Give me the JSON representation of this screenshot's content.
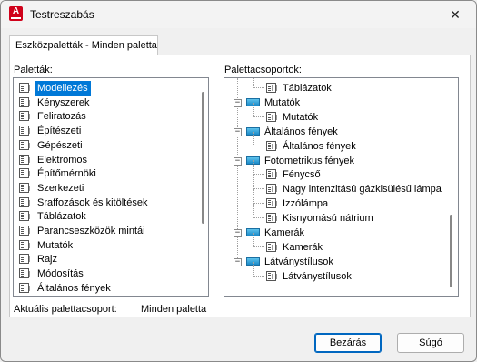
{
  "window": {
    "title": "Testreszabás",
    "close_glyph": "✕"
  },
  "tab": {
    "label": "Eszközpaletták - Minden paletta"
  },
  "palettes": {
    "label": "Paletták:",
    "selected": "Modellezés",
    "items": [
      "Modellezés",
      "Kényszerek",
      "Feliratozás",
      "Építészeti",
      "Gépészeti",
      "Elektromos",
      "Építőmérnöki",
      "Szerkezeti",
      "Sraffozások és kitöltések",
      "Táblázatok",
      "Parancseszközök mintái",
      "Mutatók",
      "Rajz",
      "Módosítás",
      "Általános fények"
    ]
  },
  "groups": {
    "label": "Palettacsoportok:",
    "rows": [
      {
        "type": "item",
        "text": "Táblázatok"
      },
      {
        "type": "group",
        "text": "Mutatók"
      },
      {
        "type": "item",
        "text": "Mutatók"
      },
      {
        "type": "group",
        "text": "Általános fények"
      },
      {
        "type": "item",
        "text": "Általános fények"
      },
      {
        "type": "group",
        "text": "Fotometrikus fények"
      },
      {
        "type": "item",
        "text": "Fénycső"
      },
      {
        "type": "item",
        "text": "Nagy intenzitású gázkisülésű lámpa"
      },
      {
        "type": "item",
        "text": "Izzólámpa"
      },
      {
        "type": "item",
        "text": "Kisnyomású nátrium"
      },
      {
        "type": "group",
        "text": "Kamerák"
      },
      {
        "type": "item",
        "text": "Kamerák"
      },
      {
        "type": "group",
        "text": "Látványstílusok"
      },
      {
        "type": "item",
        "text": "Látványstílusok"
      }
    ]
  },
  "current": {
    "label": "Aktuális palettacsoport:",
    "value": "Minden paletta"
  },
  "buttons": {
    "close": "Bezárás",
    "help": "Súgó"
  },
  "colors": {
    "selection": "#0078d7",
    "default_border": "#0067c0",
    "app_icon": "#d0021b"
  },
  "icons": {
    "palette": "palette-icon",
    "group": "palette-group-icon",
    "expander": "collapse-minus-icon"
  }
}
